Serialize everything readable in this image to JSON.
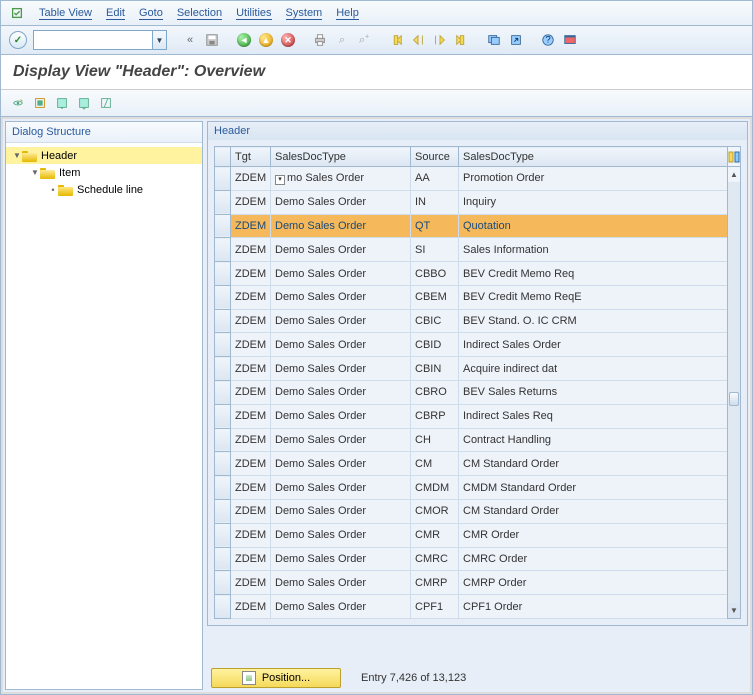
{
  "menu": {
    "items": [
      "Table View",
      "Edit",
      "Goto",
      "Selection",
      "Utilities",
      "System",
      "Help"
    ]
  },
  "page_title": "Display View \"Header\": Overview",
  "tree": {
    "header": "Dialog Structure",
    "nodes": [
      {
        "label": "Header",
        "level": 0,
        "open": true,
        "selected": true
      },
      {
        "label": "Item",
        "level": 1,
        "open": true,
        "selected": false
      },
      {
        "label": "Schedule line",
        "level": 2,
        "open": false,
        "selected": false
      }
    ]
  },
  "group_title": "Header",
  "columns": [
    "",
    "Tgt",
    "SalesDocType",
    "Source",
    "SalesDocType"
  ],
  "rows": [
    {
      "tgt": "ZDEM",
      "c1": "mo Sales Order",
      "src": "AA",
      "c2": "Promotion Order",
      "focus": true
    },
    {
      "tgt": "ZDEM",
      "c1": "Demo Sales Order",
      "src": "IN",
      "c2": "Inquiry"
    },
    {
      "tgt": "ZDEM",
      "c1": "Demo Sales Order",
      "src": "QT",
      "c2": "Quotation",
      "selected": true
    },
    {
      "tgt": "ZDEM",
      "c1": "Demo Sales Order",
      "src": "SI",
      "c2": "Sales Information"
    },
    {
      "tgt": "ZDEM",
      "c1": "Demo Sales Order",
      "src": "CBBO",
      "c2": "BEV Credit Memo Req"
    },
    {
      "tgt": "ZDEM",
      "c1": "Demo Sales Order",
      "src": "CBEM",
      "c2": "BEV Credit Memo ReqE"
    },
    {
      "tgt": "ZDEM",
      "c1": "Demo Sales Order",
      "src": "CBIC",
      "c2": "BEV Stand. O. IC CRM"
    },
    {
      "tgt": "ZDEM",
      "c1": "Demo Sales Order",
      "src": "CBID",
      "c2": "Indirect Sales Order"
    },
    {
      "tgt": "ZDEM",
      "c1": "Demo Sales Order",
      "src": "CBIN",
      "c2": "Acquire indirect dat"
    },
    {
      "tgt": "ZDEM",
      "c1": "Demo Sales Order",
      "src": "CBRO",
      "c2": "BEV Sales Returns"
    },
    {
      "tgt": "ZDEM",
      "c1": "Demo Sales Order",
      "src": "CBRP",
      "c2": "Indirect Sales Req"
    },
    {
      "tgt": "ZDEM",
      "c1": "Demo Sales Order",
      "src": "CH",
      "c2": "Contract Handling"
    },
    {
      "tgt": "ZDEM",
      "c1": "Demo Sales Order",
      "src": "CM",
      "c2": "CM Standard Order"
    },
    {
      "tgt": "ZDEM",
      "c1": "Demo Sales Order",
      "src": "CMDM",
      "c2": "CMDM Standard Order"
    },
    {
      "tgt": "ZDEM",
      "c1": "Demo Sales Order",
      "src": "CMOR",
      "c2": "CM Standard Order"
    },
    {
      "tgt": "ZDEM",
      "c1": "Demo Sales Order",
      "src": "CMR",
      "c2": "CMR Order"
    },
    {
      "tgt": "ZDEM",
      "c1": "Demo Sales Order",
      "src": "CMRC",
      "c2": "CMRC Order"
    },
    {
      "tgt": "ZDEM",
      "c1": "Demo Sales Order",
      "src": "CMRP",
      "c2": "CMRP Order"
    },
    {
      "tgt": "ZDEM",
      "c1": "Demo Sales Order",
      "src": "CPF1",
      "c2": "CPF1 Order"
    }
  ],
  "position_label": "Position...",
  "entry_text": "Entry 7,426 of 13,123"
}
